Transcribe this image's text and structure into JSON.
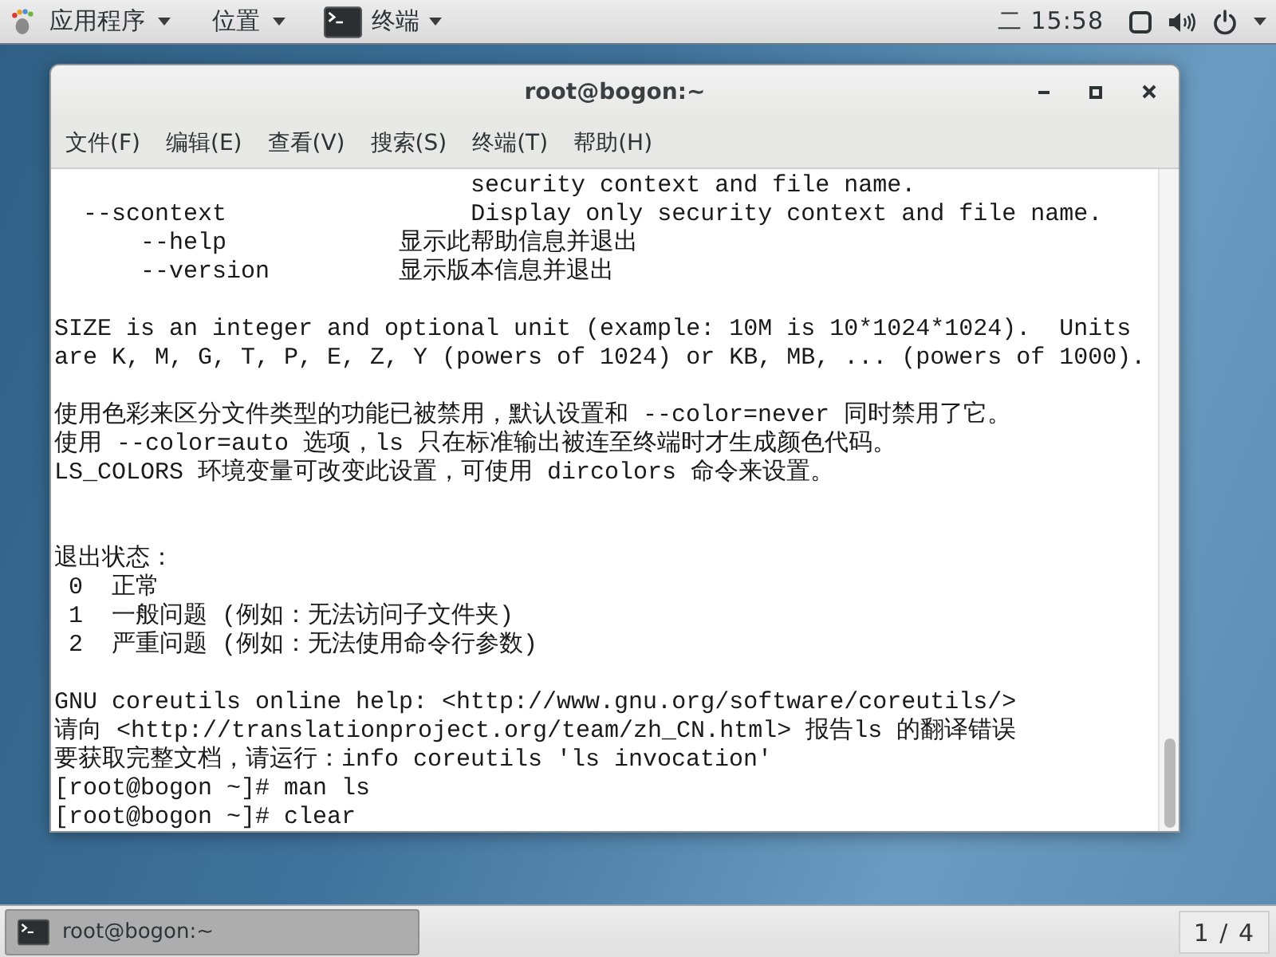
{
  "top_bar": {
    "menus": [
      {
        "label": "应用程序"
      },
      {
        "label": "位置"
      }
    ],
    "active_app": {
      "label": "终端"
    },
    "clock": "二 15:58"
  },
  "window": {
    "title": "root@bogon:~",
    "menu": [
      "文件(F)",
      "编辑(E)",
      "查看(V)",
      "搜索(S)",
      "终端(T)",
      "帮助(H)"
    ]
  },
  "terminal": {
    "lines": [
      {
        "kind": "text",
        "text": "                             security context and file name."
      },
      {
        "kind": "text",
        "text": "  --scontext                 Display only security context and file name."
      },
      {
        "kind": "text",
        "text": "      --help            显示此帮助信息并退出"
      },
      {
        "kind": "text",
        "text": "      --version         显示版本信息并退出"
      },
      {
        "kind": "blank"
      },
      {
        "kind": "text",
        "text": "SIZE is an integer and optional unit (example: 10M is 10*1024*1024).  Units"
      },
      {
        "kind": "text",
        "text": "are K, M, G, T, P, E, Z, Y (powers of 1024) or KB, MB, ... (powers of 1000)."
      },
      {
        "kind": "blank"
      },
      {
        "kind": "text",
        "text": "使用色彩来区分文件类型的功能已被禁用，默认设置和 --color=never 同时禁用了它。"
      },
      {
        "kind": "text",
        "text": "使用 --color=auto 选项，ls 只在标准输出被连至终端时才生成颜色代码。"
      },
      {
        "kind": "text",
        "text": "LS_COLORS 环境变量可改变此设置，可使用 dircolors 命令来设置。"
      },
      {
        "kind": "blank"
      },
      {
        "kind": "blank"
      },
      {
        "kind": "text",
        "text": "退出状态："
      },
      {
        "kind": "text",
        "text": " 0  正常"
      },
      {
        "kind": "text",
        "text": " 1  一般问题 (例如：无法访问子文件夹)"
      },
      {
        "kind": "text",
        "text": " 2  严重问题 (例如：无法使用命令行参数)"
      },
      {
        "kind": "blank"
      },
      {
        "kind": "text",
        "text": "GNU coreutils online help: <http://www.gnu.org/software/coreutils/>"
      },
      {
        "kind": "text",
        "text": "请向 <http://translationproject.org/team/zh_CN.html> 报告ls 的翻译错误"
      },
      {
        "kind": "text",
        "text": "要获取完整文档，请运行：info coreutils 'ls invocation'"
      },
      {
        "kind": "text",
        "text": "[root@bogon ~]# man ls"
      },
      {
        "kind": "text",
        "text": "[root@bogon ~]# clear"
      }
    ]
  },
  "taskbar": {
    "windows": [
      {
        "label": "root@bogon:~",
        "selected": true
      }
    ],
    "workspace": "1 / 4"
  }
}
